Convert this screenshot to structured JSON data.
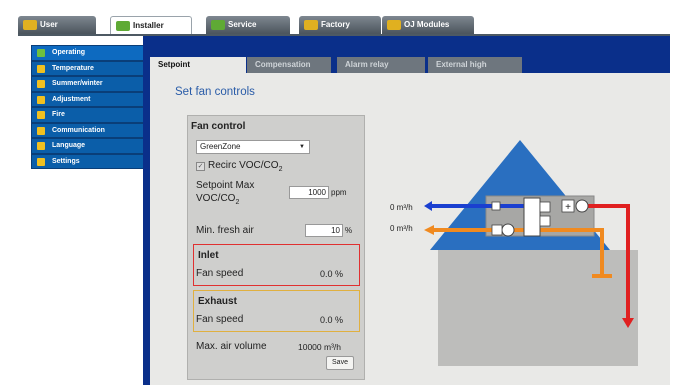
{
  "top_tabs": [
    {
      "label": "User",
      "active": false
    },
    {
      "label": "Installer",
      "active": true
    },
    {
      "label": "Service",
      "active": false
    },
    {
      "label": "Factory",
      "active": false
    },
    {
      "label": "OJ Modules",
      "active": false
    }
  ],
  "side_menu": [
    {
      "label": "Operating",
      "header": true
    },
    {
      "label": "Temperature"
    },
    {
      "label": "Summer/winter"
    },
    {
      "label": "Adjustment"
    },
    {
      "label": "Fire"
    },
    {
      "label": "Communication"
    },
    {
      "label": "Language"
    },
    {
      "label": "Settings"
    }
  ],
  "content_tabs": [
    {
      "label": "Setpoint",
      "active": true
    },
    {
      "label": "Compensation",
      "active": false
    },
    {
      "label": "Alarm relay",
      "active": false
    },
    {
      "label": "External high",
      "active": false
    }
  ],
  "page_title": "Set fan controls",
  "fan_control": {
    "title": "Fan control",
    "mode_select": "GreenZone",
    "recirc_label": "Recirc VOC/CO",
    "recirc_sub": "2",
    "recirc_checked": true,
    "setpoint_label_1": "Setpoint Max",
    "setpoint_label_2": "VOC/CO",
    "setpoint_sub": "2",
    "setpoint_value": "1000",
    "setpoint_unit": "ppm",
    "min_fresh_label": "Min. fresh air",
    "min_fresh_value": "10",
    "min_fresh_unit": "%",
    "inlet": {
      "title": "Inlet",
      "label": "Fan speed",
      "value": "0.0 %"
    },
    "exhaust": {
      "title": "Exhaust",
      "label": "Fan speed",
      "value": "0.0 %"
    },
    "max_air_label": "Max. air volume",
    "max_air_value": "10000 m³/h",
    "save_label": "Save"
  },
  "diagram": {
    "supply_flow": "0 m³/h",
    "exhaust_flow": "0 m³/h",
    "colors": {
      "supply": "#1a3fd0",
      "exhaust": "#f08a20",
      "extract": "#e02020",
      "roof": "#2a6fc0"
    }
  }
}
